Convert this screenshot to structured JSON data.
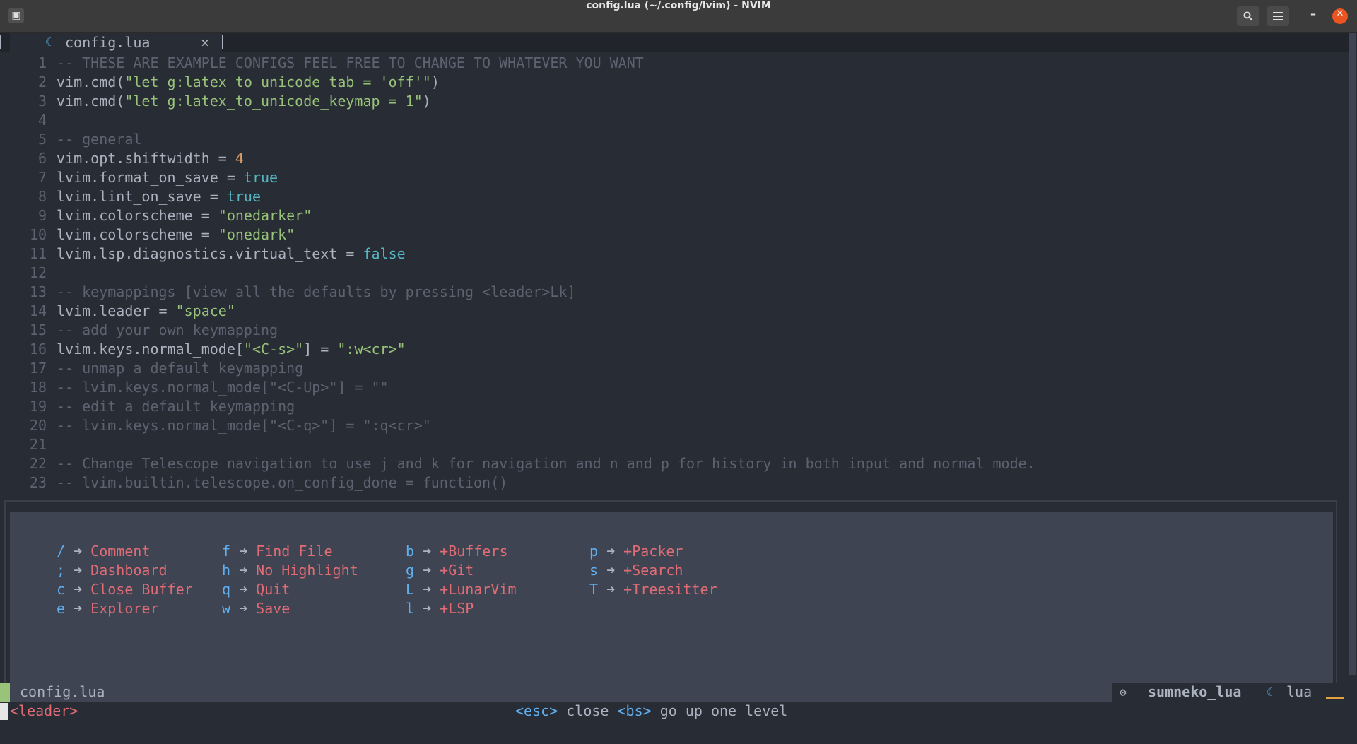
{
  "window": {
    "title": "config.lua (~/.config/lvim) - NVIM",
    "app_icon": "terminal-icon",
    "search_icon": "search-icon",
    "menu_icon": "hamburger-menu-icon",
    "minimize_glyph": "–",
    "close_glyph": "✕"
  },
  "tab": {
    "icon_glyph": "☾",
    "name": "config.lua",
    "close_glyph": "×"
  },
  "code_lines": [
    {
      "n": "1",
      "parts": [
        {
          "t": "-- THESE ARE EXAMPLE CONFIGS FEEL FREE TO CHANGE TO WHATEVER YOU WANT",
          "c": "com"
        }
      ]
    },
    {
      "n": "2",
      "parts": [
        {
          "t": "vim.cmd(",
          "c": "def"
        },
        {
          "t": "\"let g:latex_to_unicode_tab = 'off'\"",
          "c": "str"
        },
        {
          "t": ")",
          "c": "def"
        }
      ]
    },
    {
      "n": "3",
      "parts": [
        {
          "t": "vim.cmd(",
          "c": "def"
        },
        {
          "t": "\"let g:latex_to_unicode_keymap = 1\"",
          "c": "str"
        },
        {
          "t": ")",
          "c": "def"
        }
      ]
    },
    {
      "n": "4",
      "parts": []
    },
    {
      "n": "5",
      "parts": [
        {
          "t": "-- general",
          "c": "com"
        }
      ]
    },
    {
      "n": "6",
      "parts": [
        {
          "t": "vim.opt.shiftwidth = ",
          "c": "def"
        },
        {
          "t": "4",
          "c": "num"
        }
      ]
    },
    {
      "n": "7",
      "parts": [
        {
          "t": "lvim.format_on_save = ",
          "c": "def"
        },
        {
          "t": "true",
          "c": "kw"
        }
      ]
    },
    {
      "n": "8",
      "parts": [
        {
          "t": "lvim.lint_on_save = ",
          "c": "def"
        },
        {
          "t": "true",
          "c": "kw"
        }
      ]
    },
    {
      "n": "9",
      "parts": [
        {
          "t": "lvim.colorscheme = ",
          "c": "def"
        },
        {
          "t": "\"onedarker\"",
          "c": "str"
        }
      ]
    },
    {
      "n": "10",
      "parts": [
        {
          "t": "lvim.colorscheme = ",
          "c": "def"
        },
        {
          "t": "\"onedark\"",
          "c": "str"
        }
      ]
    },
    {
      "n": "11",
      "parts": [
        {
          "t": "lvim.lsp.diagnostics.virtual_text = ",
          "c": "def"
        },
        {
          "t": "false",
          "c": "kw"
        }
      ]
    },
    {
      "n": "12",
      "parts": []
    },
    {
      "n": "13",
      "parts": [
        {
          "t": "-- keymappings [view all the defaults by pressing <leader>Lk]",
          "c": "com"
        }
      ]
    },
    {
      "n": "14",
      "parts": [
        {
          "t": "lvim.leader = ",
          "c": "def"
        },
        {
          "t": "\"space\"",
          "c": "str"
        }
      ]
    },
    {
      "n": "15",
      "parts": [
        {
          "t": "-- add your own keymapping",
          "c": "com"
        }
      ]
    },
    {
      "n": "16",
      "parts": [
        {
          "t": "lvim.keys.normal_mode[",
          "c": "def"
        },
        {
          "t": "\"<C-s>\"",
          "c": "str"
        },
        {
          "t": "] = ",
          "c": "def"
        },
        {
          "t": "\":w<cr>\"",
          "c": "str"
        }
      ]
    },
    {
      "n": "17",
      "parts": [
        {
          "t": "-- unmap a default keymapping",
          "c": "com"
        }
      ]
    },
    {
      "n": "18",
      "parts": [
        {
          "t": "-- lvim.keys.normal_mode[\"<C-Up>\"] = \"\"",
          "c": "com"
        }
      ]
    },
    {
      "n": "19",
      "parts": [
        {
          "t": "-- edit a default keymapping",
          "c": "com"
        }
      ]
    },
    {
      "n": "20",
      "parts": [
        {
          "t": "-- lvim.keys.normal_mode[\"<C-q>\"] = \":q<cr>\"",
          "c": "com"
        }
      ]
    },
    {
      "n": "21",
      "parts": []
    },
    {
      "n": "22",
      "parts": [
        {
          "t": "-- Change Telescope navigation to use j and k for navigation and n and p for history in both input and normal mode.",
          "c": "com"
        }
      ]
    },
    {
      "n": "23",
      "parts": [
        {
          "t": "-- lvim.builtin.telescope.on_config_done = function()",
          "c": "com"
        }
      ]
    }
  ],
  "which_key": {
    "arrow": "➜",
    "columns": [
      [
        {
          "key": "/",
          "label": "Comment"
        },
        {
          "key": ";",
          "label": "Dashboard"
        },
        {
          "key": "c",
          "label": "Close Buffer"
        },
        {
          "key": "e",
          "label": "Explorer"
        }
      ],
      [
        {
          "key": "f",
          "label": "Find File"
        },
        {
          "key": "h",
          "label": "No Highlight"
        },
        {
          "key": "q",
          "label": "Quit"
        },
        {
          "key": "w",
          "label": "Save"
        }
      ],
      [
        {
          "key": "b",
          "label": "+Buffers"
        },
        {
          "key": "g",
          "label": "+Git"
        },
        {
          "key": "L",
          "label": "+LunarVim"
        },
        {
          "key": "l",
          "label": "+LSP"
        }
      ],
      [
        {
          "key": "p",
          "label": "+Packer"
        },
        {
          "key": "s",
          "label": "+Search"
        },
        {
          "key": "T",
          "label": "+Treesitter"
        }
      ]
    ]
  },
  "statusline": {
    "file": "config.lua",
    "lsp_icon": "⚙",
    "lsp_name": "sumneko_lua",
    "filetype_icon": "☾",
    "filetype": "lua"
  },
  "cmdline": {
    "leader": "<leader>",
    "esc_key": "<esc>",
    "esc_text": " close ",
    "bs_key": "<bs>",
    "bs_text": " go up one level"
  }
}
